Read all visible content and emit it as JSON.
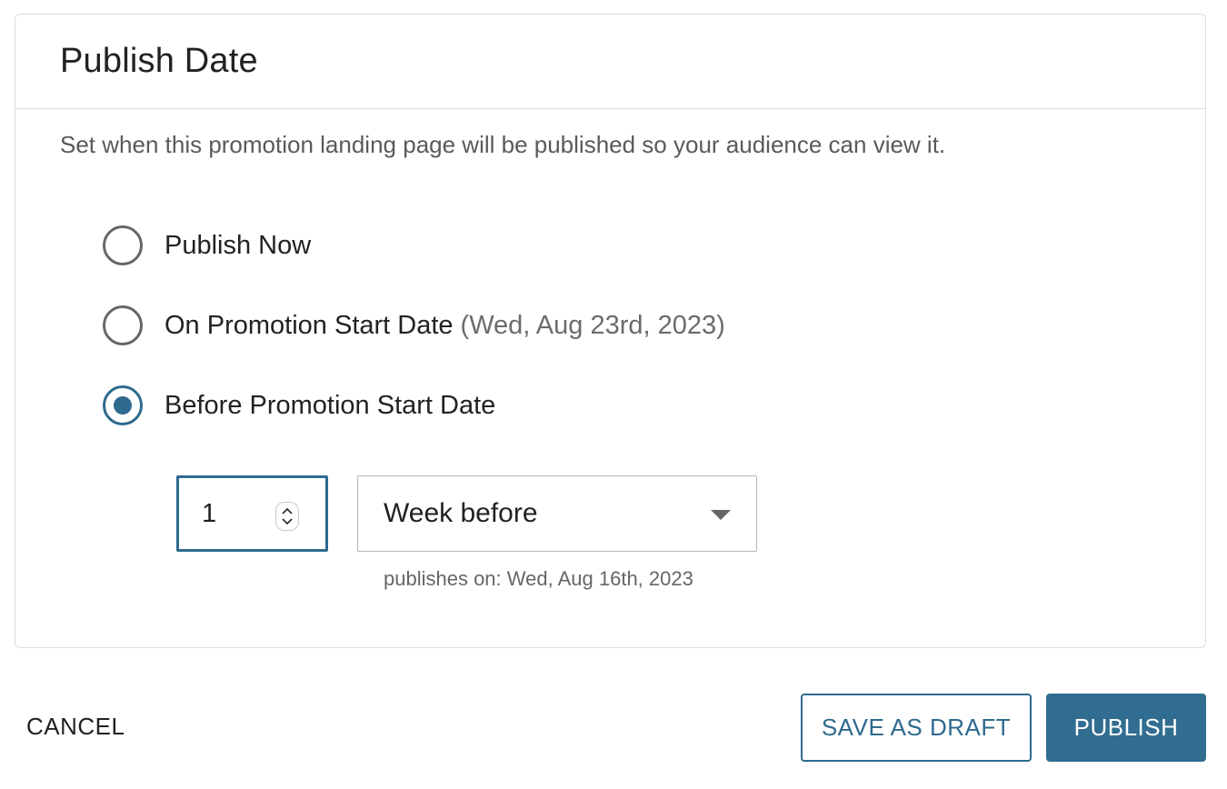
{
  "card": {
    "title": "Publish Date",
    "description": "Set when this promotion landing page will be published so your audience can view it."
  },
  "options": [
    {
      "label": "Publish Now",
      "sub": "",
      "checked": false
    },
    {
      "label": "On Promotion Start Date",
      "sub": "(Wed, Aug 23rd, 2023)",
      "checked": false
    },
    {
      "label": "Before Promotion Start Date",
      "sub": "",
      "checked": true
    }
  ],
  "offset": {
    "amount": "1",
    "unit": "Week before",
    "publishes_on": "publishes on: Wed, Aug 16th, 2023"
  },
  "footer": {
    "cancel_label": "CANCEL",
    "draft_label": "SAVE AS DRAFT",
    "publish_label": "PUBLISH"
  },
  "colors": {
    "accent": "#2e6a8e",
    "publish_bg": "#316d90"
  },
  "icons": {
    "spinner": "up-down-stepper-icon",
    "dropdown": "caret-down-icon"
  }
}
